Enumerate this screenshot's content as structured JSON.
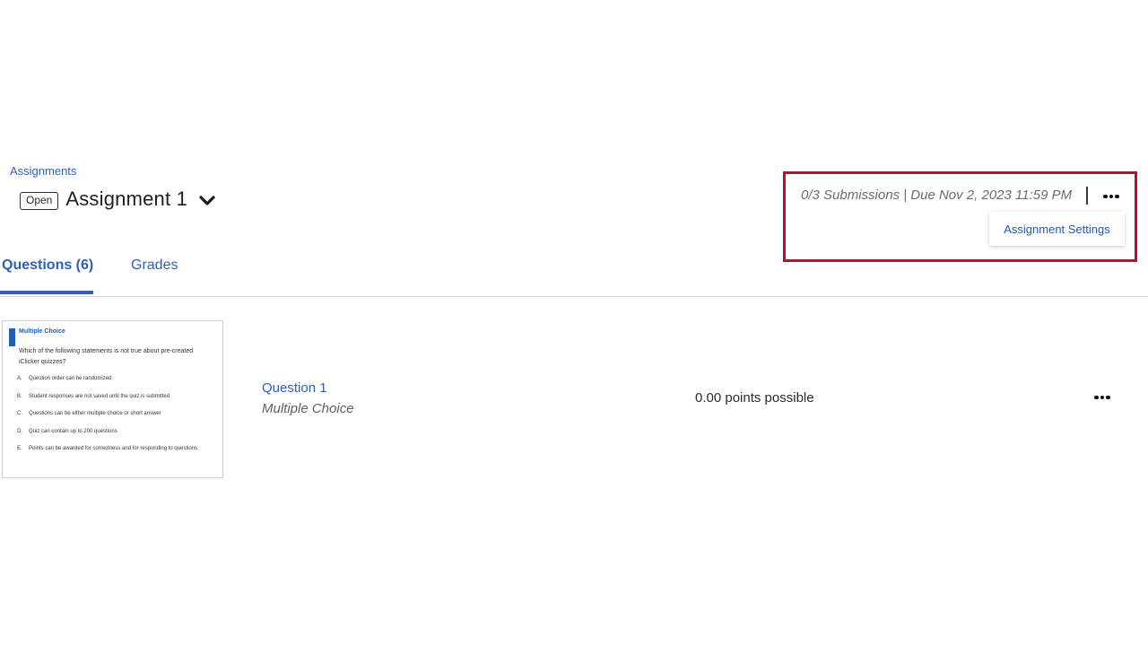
{
  "breadcrumb": {
    "label": "Assignments"
  },
  "assignment": {
    "status": "Open",
    "title": "Assignment 1"
  },
  "meta": {
    "submissions_due": "0/3 Submissions | Due Nov 2, 2023 11:59 PM",
    "menu": {
      "settings_label": "Assignment Settings"
    }
  },
  "tabs": [
    {
      "label": "Questions (6)",
      "active": true
    },
    {
      "label": "Grades",
      "active": false
    }
  ],
  "questions": [
    {
      "title": "Question 1",
      "type": "Multiple Choice",
      "points": "0.00 points possible",
      "thumbnail": {
        "type_label": "Multiple Choice",
        "text": "Which of the following statements is not true about pre-created iClicker quizzes?",
        "options": [
          {
            "letter": "A.",
            "text": "Question order can be randomized"
          },
          {
            "letter": "B.",
            "text": "Student responses are not saved until the quiz is submitted"
          },
          {
            "letter": "C.",
            "text": "Questions can be either multiple choice or short answer"
          },
          {
            "letter": "D.",
            "text": "Quiz can contain up to 200 questions"
          },
          {
            "letter": "E.",
            "text": "Points can be awarded for correctness and for responding to questions"
          }
        ]
      }
    }
  ],
  "colors": {
    "accent": "#2f5fb8",
    "highlight_box": "#b5122e"
  },
  "icons": {
    "title_dropdown": "chevron-down-icon",
    "more_options": "more-horizontal-icon"
  }
}
